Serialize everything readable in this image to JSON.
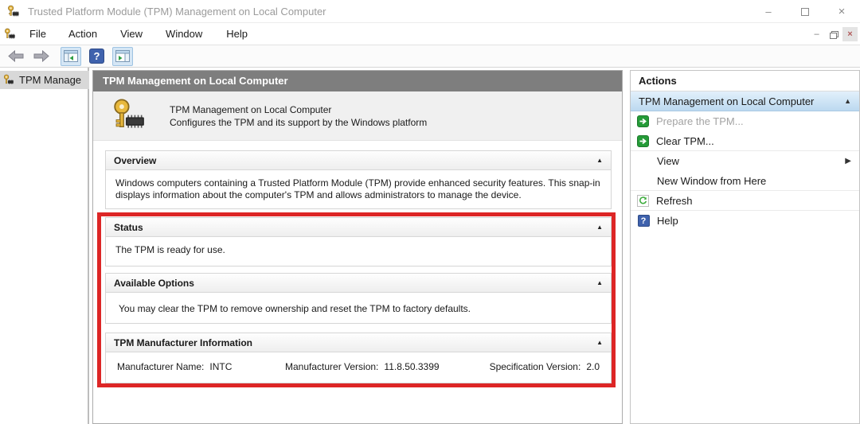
{
  "window": {
    "title": "Trusted Platform Module (TPM) Management on Local Computer",
    "controls": {
      "minimize_glyph": "–",
      "close_glyph": "×"
    }
  },
  "menu": {
    "items": [
      "File",
      "Action",
      "View",
      "Window",
      "Help"
    ],
    "child_controls": {
      "minimize_glyph": "–",
      "close_glyph": "×"
    }
  },
  "tree": {
    "selected_label": "TPM Manage"
  },
  "main": {
    "header_title": "TPM Management on Local Computer",
    "banner": {
      "title": "TPM Management on Local Computer",
      "subtitle": "Configures the TPM and its support by the Windows platform"
    },
    "sections": {
      "overview": {
        "title": "Overview",
        "body": "Windows computers containing a Trusted Platform Module (TPM) provide enhanced security features. This snap-in displays information about the computer's TPM and allows administrators to manage the device."
      },
      "status": {
        "title": "Status",
        "body": "The TPM is ready for use."
      },
      "options": {
        "title": "Available Options",
        "body": "You may clear the TPM to remove ownership and reset the TPM to factory defaults."
      },
      "manufacturer": {
        "title": "TPM Manufacturer Information",
        "fields": [
          {
            "label": "Manufacturer Name:",
            "value": "INTC"
          },
          {
            "label": "Manufacturer Version:",
            "value": "11.8.50.3399"
          },
          {
            "label": "Specification Version:",
            "value": "2.0"
          }
        ]
      }
    }
  },
  "actions": {
    "header": "Actions",
    "group_title": "TPM Management on Local Computer",
    "items": [
      {
        "label": "Prepare the TPM...",
        "disabled": true
      },
      {
        "label": "Clear TPM...",
        "disabled": false
      },
      {
        "label": "View",
        "submenu": true
      },
      {
        "label": "New Window from Here"
      },
      {
        "label": "Refresh"
      },
      {
        "label": "Help"
      }
    ]
  },
  "icons": {
    "collapse_up_glyph": "▲",
    "submenu_right_glyph": "▶",
    "help_glyph": "?"
  },
  "colors": {
    "highlight_red": "#dd2626",
    "main_header_gray": "#7e7e7e",
    "selected_action_blue": "#bcd9f0",
    "action_green": "#259b38",
    "help_blue": "#3f62ad",
    "key_gold": "#e3b341"
  }
}
